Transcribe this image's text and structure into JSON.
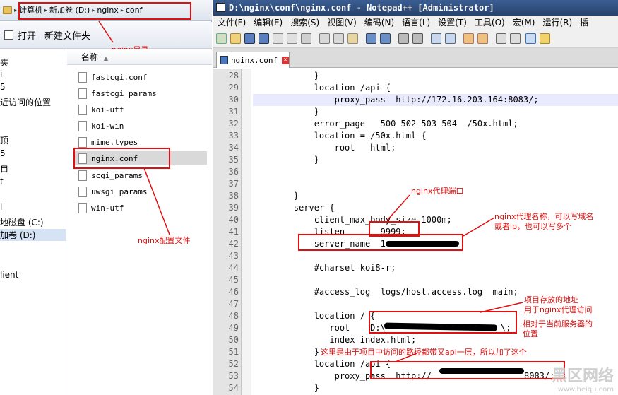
{
  "explorer": {
    "breadcrumb": [
      "计算机",
      "新加卷 (D:)",
      "nginx",
      "conf"
    ],
    "toolbar": {
      "open_label": "打开",
      "new_folder_label": "新建文件夹"
    },
    "column_header": "名称",
    "nav_items": [
      "夹",
      "i",
      "5",
      "近访问的位置",
      "顶",
      "5",
      "自",
      "t",
      "l",
      "地磁盘 (C:)",
      "加卷 (D:)",
      "lient"
    ],
    "files": [
      "fastcgi.conf",
      "fastcgi_params",
      "koi-utf",
      "koi-win",
      "mime.types",
      "nginx.conf",
      "scgi_params",
      "uwsgi_params",
      "win-utf"
    ],
    "selected_file": "nginx.conf"
  },
  "notepad": {
    "title": "D:\\nginx\\conf\\nginx.conf - Notepad++ [Administrator]",
    "menu": [
      "文件(F)",
      "编辑(E)",
      "搜索(S)",
      "视图(V)",
      "编码(N)",
      "语言(L)",
      "设置(T)",
      "工具(O)",
      "宏(M)",
      "运行(R)",
      "插"
    ],
    "tab_label": "nginx.conf",
    "lines": [
      {
        "n": "28",
        "t": "            }"
      },
      {
        "n": "29",
        "t": "            location /api {"
      },
      {
        "n": "30",
        "t": "                proxy_pass  http://172.16.203.164:8083/;"
      },
      {
        "n": "31",
        "t": "            }"
      },
      {
        "n": "32",
        "t": "            error_page   500 502 503 504  /50x.html;"
      },
      {
        "n": "33",
        "t": "            location = /50x.html {"
      },
      {
        "n": "34",
        "t": "                root   html;"
      },
      {
        "n": "35",
        "t": "            }"
      },
      {
        "n": "36",
        "t": ""
      },
      {
        "n": "37",
        "t": ""
      },
      {
        "n": "38",
        "t": "        }"
      },
      {
        "n": "39",
        "t": "        server {"
      },
      {
        "n": "40",
        "t": "            client_max_body_size 1000m;"
      },
      {
        "n": "41",
        "t": "            listen       9999;"
      },
      {
        "n": "42",
        "t": "            server_name  1"
      },
      {
        "n": "43",
        "t": ""
      },
      {
        "n": "44",
        "t": "            #charset koi8-r;"
      },
      {
        "n": "45",
        "t": ""
      },
      {
        "n": "46",
        "t": "            #access_log  logs/host.access.log  main;"
      },
      {
        "n": "47",
        "t": ""
      },
      {
        "n": "48",
        "t": "            location / {"
      },
      {
        "n": "49",
        "t": "               root    D:\\"
      },
      {
        "n": "50",
        "t": "               index index.html;"
      },
      {
        "n": "51",
        "t": "            }"
      },
      {
        "n": "52",
        "t": "            location /api {"
      },
      {
        "n": "53",
        "t": "                proxy_pass  http://"
      },
      {
        "n": "54",
        "t": "            }"
      }
    ],
    "line49_tail": "\\;",
    "line53_tail": "8083/;"
  },
  "annotations": {
    "nginx_dir": "nginx目录",
    "nginx_conf_file": "nginx配置文件",
    "proxy_port": "nginx代理端口",
    "proxy_name_1": "nginx代理名称，可以写域名",
    "proxy_name_2": "或者ip，也可以写多个",
    "proj_path_1": "项目存放的地址",
    "proj_path_2": "用于nginx代理访问",
    "relative_1": "相对于当前服务器的",
    "relative_2": "位置",
    "api_note": "这里是由于项目中访问的路径都带又api一层，所以加了这个"
  },
  "watermark": {
    "text": "黑区网络",
    "url": "www.heiqu.com"
  },
  "colors": {
    "annotation": "#e01010",
    "titlebar": "#2f4f80"
  }
}
